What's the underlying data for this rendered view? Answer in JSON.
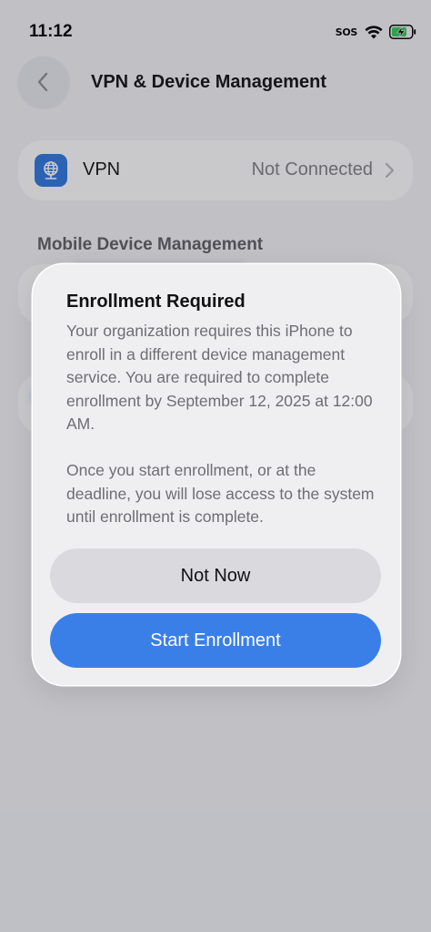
{
  "status_bar": {
    "time": "11:12",
    "sos": "SOS"
  },
  "nav": {
    "title": "VPN & Device Management"
  },
  "vpn_row": {
    "label": "VPN",
    "status": "Not Connected"
  },
  "section": {
    "header": "Mobile Device Management"
  },
  "alert": {
    "title": "Enrollment Required",
    "message_1": "Your organization requires this iPhone to enroll in a different device management service. You are required to complete enrollment by September 12, 2025 at 12:00 AM.",
    "message_2": "Once you start enrollment, or at the deadline, you will lose access to the system until enrollment is complete.",
    "secondary_button": "Not Now",
    "primary_button": "Start Enrollment"
  },
  "colors": {
    "accent": "#3a7fe8",
    "vpn_icon": "#2c74dd",
    "battery_charging": "#35c759"
  },
  "icons": {
    "back": "chevron-left-icon",
    "vpn": "globe-network-icon",
    "row_chevron": "chevron-right-icon",
    "wifi": "wifi-icon",
    "battery": "battery-charging-icon"
  }
}
